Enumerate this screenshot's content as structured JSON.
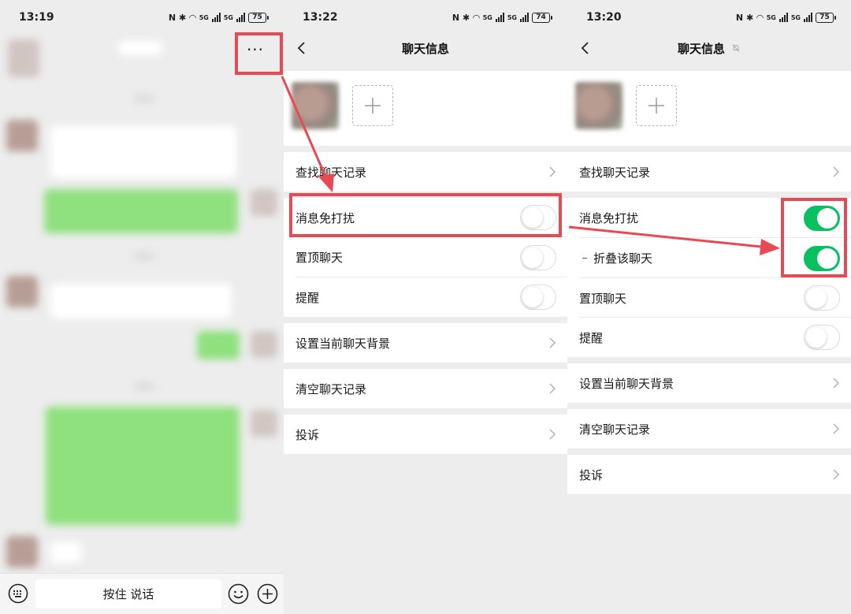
{
  "colors": {
    "accent_green": "#07c160",
    "annotation_red": "#e84a55",
    "bg": "#ededed"
  },
  "panel1": {
    "status": {
      "time": "13:19",
      "battery": "75"
    },
    "more_label": "···",
    "input": {
      "talk_label": "按住 说话"
    }
  },
  "panel2": {
    "status": {
      "time": "13:22",
      "battery": "74"
    },
    "title": "聊天信息",
    "rows": {
      "search": "查找聊天记录",
      "mute": "消息免打扰",
      "pin": "置顶聊天",
      "remind": "提醒",
      "background": "设置当前聊天背景",
      "clear": "清空聊天记录",
      "report": "投诉"
    },
    "toggles": {
      "mute": false,
      "pin": false,
      "remind": false
    }
  },
  "panel3": {
    "status": {
      "time": "13:20",
      "battery": "75"
    },
    "title": "聊天信息",
    "rows": {
      "search": "查找聊天记录",
      "mute": "消息免打扰",
      "fold": "折叠该聊天",
      "pin": "置顶聊天",
      "remind": "提醒",
      "background": "设置当前聊天背景",
      "clear": "清空聊天记录",
      "report": "投诉"
    },
    "toggles": {
      "mute": true,
      "fold": true,
      "pin": false,
      "remind": false
    }
  },
  "icons": [
    "back-icon",
    "add-member-icon",
    "chevron-right-icon",
    "keyboard-icon",
    "emoji-icon",
    "plus-icon",
    "mute-bell-icon",
    "nfc-icon",
    "bluetooth-icon",
    "wifi-icon",
    "signal-icon",
    "battery-icon"
  ]
}
